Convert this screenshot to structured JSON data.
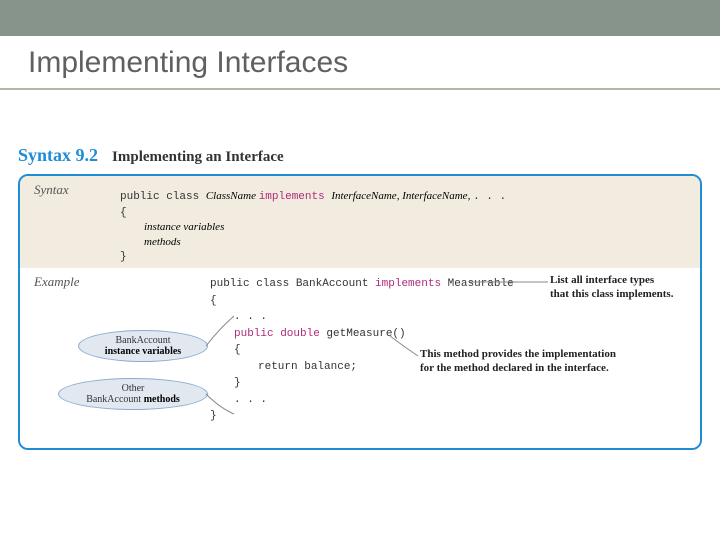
{
  "slide": {
    "title": "Implementing Interfaces"
  },
  "header": {
    "label": "Syntax 9.2",
    "subtitle": "Implementing an Interface"
  },
  "syntax": {
    "section_label": "Syntax",
    "line1_pre": "public class ",
    "line1_cn": "ClassName ",
    "line1_kw": "implements ",
    "line1_in1": "InterfaceName, ",
    "line1_in2": "InterfaceName, ",
    "line1_post": ". . .",
    "line2": "{",
    "line3": "instance variables",
    "line4": "methods",
    "line5": "}"
  },
  "example": {
    "section_label": "Example",
    "l1_a": "public class ",
    "l1_b": "BankAccount ",
    "l1_kw": "implements ",
    "l1_c": "Measurable",
    "l2": "{",
    "l3": ". . .",
    "l4_kw": "public double ",
    "l4_b": "getMeasure()",
    "l5": "{",
    "l6_a": "return ",
    "l6_b": "balance;",
    "l7": "}",
    "l8": ". . .",
    "l9": "}"
  },
  "callouts": {
    "c1_a": "BankAccount",
    "c1_b": "instance variables",
    "c2_a": "Other",
    "c2_b": "BankAccount ",
    "c2_c": "methods"
  },
  "annots": {
    "a1_l1": "List all interface types",
    "a1_l2": "that this class implements.",
    "a2_l1": "This method provides the implementation",
    "a2_l2": "for the method declared in the interface."
  }
}
